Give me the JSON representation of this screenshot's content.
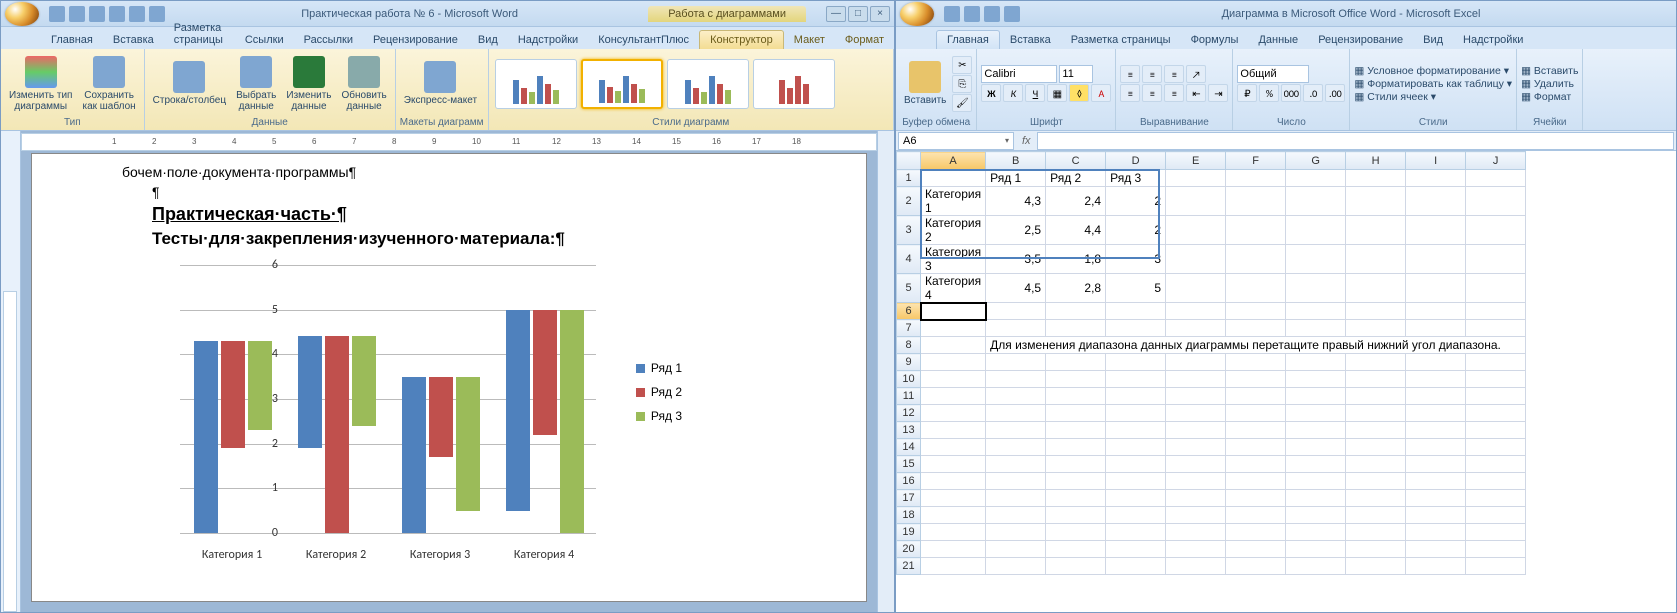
{
  "word": {
    "title": "Практическая работа  № 6 - Microsoft Word",
    "chart_tools": "Работа с диаграммами",
    "tabs": [
      "Главная",
      "Вставка",
      "Разметка страницы",
      "Ссылки",
      "Рассылки",
      "Рецензирование",
      "Вид",
      "Надстройки",
      "КонсультантПлюс"
    ],
    "ctx_tabs": [
      "Конструктор",
      "Макет",
      "Формат"
    ],
    "ribbon": {
      "type_group": "Тип",
      "change_type": "Изменить тип\nдиаграммы",
      "save_template": "Сохранить\nкак шаблон",
      "data_group": "Данные",
      "row_col": "Строка/столбец",
      "select_data": "Выбрать\nданные",
      "edit_data": "Изменить\nданные",
      "refresh_data": "Обновить\nданные",
      "layouts_group": "Макеты диаграмм",
      "express": "Экспресс-макет",
      "styles_group": "Стили диаграмм"
    },
    "doc": {
      "line1": "бочем·поле·документа·программы¶",
      "pilcrow": "¶",
      "heading": "Практическая·часть·¶",
      "subheading": "Тесты·для·закрепления·изученного·материала:¶"
    }
  },
  "excel": {
    "title": "Диаграмма в Microsoft Office Word - Microsoft Excel",
    "tabs": [
      "Главная",
      "Вставка",
      "Разметка страницы",
      "Формулы",
      "Данные",
      "Рецензирование",
      "Вид",
      "Надстройки"
    ],
    "ribbon": {
      "clipboard": "Буфер обмена",
      "paste": "Вставить",
      "font_group": "Шрифт",
      "font_name": "Calibri",
      "font_size": "11",
      "align_group": "Выравнивание",
      "number_group": "Число",
      "number_format": "Общий",
      "styles_group": "Стили",
      "cond_fmt": "Условное форматирование",
      "fmt_table": "Форматировать как таблицу",
      "cell_styles": "Стили ячеек",
      "cells_group": "Ячейки",
      "insert_cells": "Вставить",
      "delete_cells": "Удалить",
      "format_cells": "Формат"
    },
    "name_box": "A6",
    "columns": [
      "A",
      "B",
      "C",
      "D",
      "E",
      "F",
      "G",
      "H",
      "I",
      "J"
    ],
    "headers": [
      "",
      "Ряд 1",
      "Ряд 2",
      "Ряд 3"
    ],
    "rows": [
      {
        "cat": "Категория 1",
        "v": [
          "4,3",
          "2,4",
          "2"
        ]
      },
      {
        "cat": "Категория 2",
        "v": [
          "2,5",
          "4,4",
          "2"
        ]
      },
      {
        "cat": "Категория 3",
        "v": [
          "3,5",
          "1,8",
          "3"
        ]
      },
      {
        "cat": "Категория 4",
        "v": [
          "4,5",
          "2,8",
          "5"
        ]
      }
    ],
    "hint": "Для изменения диапазона данных диаграммы перетащите правый нижний угол диапазона."
  },
  "chart_data": {
    "type": "bar",
    "categories": [
      "Категория 1",
      "Категория 2",
      "Категория 3",
      "Категория 4"
    ],
    "series": [
      {
        "name": "Ряд 1",
        "values": [
          4.3,
          2.5,
          3.5,
          4.5
        ]
      },
      {
        "name": "Ряд 2",
        "values": [
          2.4,
          4.4,
          1.8,
          2.8
        ]
      },
      {
        "name": "Ряд 3",
        "values": [
          2,
          2,
          3,
          5
        ]
      }
    ],
    "ylim": [
      0,
      6
    ],
    "yticks": [
      0,
      1,
      2,
      3,
      4,
      5,
      6
    ],
    "colors": [
      "#4f81bd",
      "#c0504d",
      "#9bbb59"
    ]
  }
}
